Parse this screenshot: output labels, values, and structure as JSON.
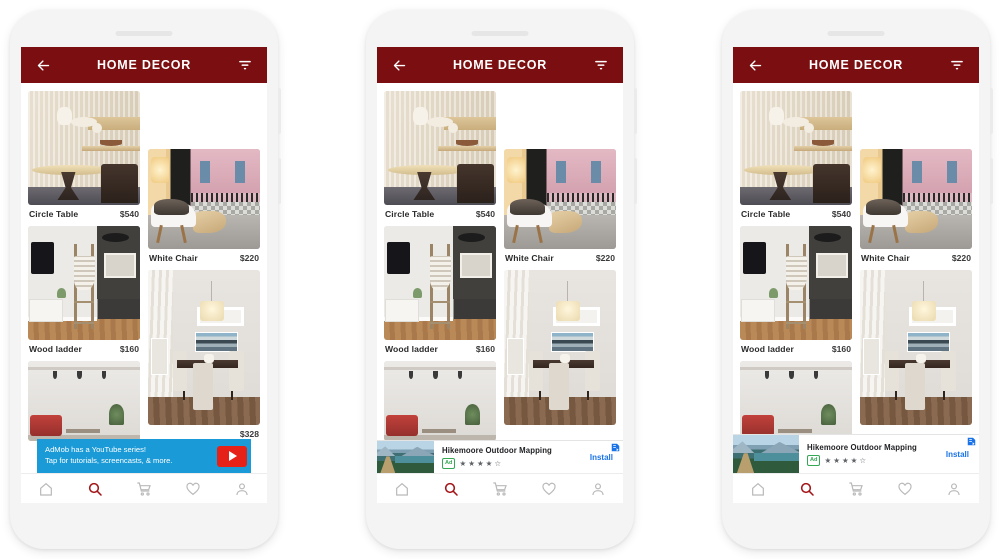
{
  "app": {
    "title": "HOME DECOR",
    "accent_color": "#7b0e10",
    "back_icon": "arrow-left-icon",
    "filter_icon": "filter-icon"
  },
  "products": [
    {
      "name": "Circle Table",
      "price": "$540",
      "scene": "s-table",
      "alt": "beige dining room with round wooden table"
    },
    {
      "name": "White Chair",
      "price": "$220",
      "scene": "s-chair",
      "alt": "white chair with fur throw near balcony window"
    },
    {
      "name": "Wood ladder",
      "price": "$160",
      "scene": "s-ladder",
      "alt": "wooden blanket ladder in bright living room"
    },
    {
      "name": "",
      "price": "",
      "scene": "s-dining",
      "alt": "dining table under drum pendant light"
    },
    {
      "name": "",
      "price": "",
      "scene": "s-loft",
      "alt": "loft living room with red sofa"
    },
    {
      "name": "",
      "price": "$328",
      "scene": "s-wood",
      "alt": "dark chair on wood floor"
    }
  ],
  "bottom_nav": [
    {
      "icon": "home-icon",
      "label": "Home",
      "active": false
    },
    {
      "icon": "search-icon",
      "label": "Search",
      "active": true
    },
    {
      "icon": "cart-icon",
      "label": "Cart",
      "active": false
    },
    {
      "icon": "heart-icon",
      "label": "Wishlist",
      "active": false
    },
    {
      "icon": "person-icon",
      "label": "Account",
      "active": false
    }
  ],
  "ads": {
    "admob_house": {
      "line1": "AdMob has a YouTube series!",
      "line2": "Tap for tutorials, screencasts, & more.",
      "background_color": "#1a9ad7",
      "play_icon": "youtube-play-icon"
    },
    "install_ad": {
      "title": "Hikemoore Outdoor Mapping",
      "badge": "Ad",
      "stars_filled": 4,
      "stars_total": 5,
      "cta": "Install",
      "adchoices_icon": "adchoices-icon",
      "thumb_scene": "s-hike"
    }
  },
  "phones": [
    {
      "id": "phone-1",
      "ad_type": "admob_house"
    },
    {
      "id": "phone-2",
      "ad_type": "install_ad",
      "ad_size": "sm"
    },
    {
      "id": "phone-3",
      "ad_type": "install_ad",
      "ad_size": "lg"
    }
  ]
}
